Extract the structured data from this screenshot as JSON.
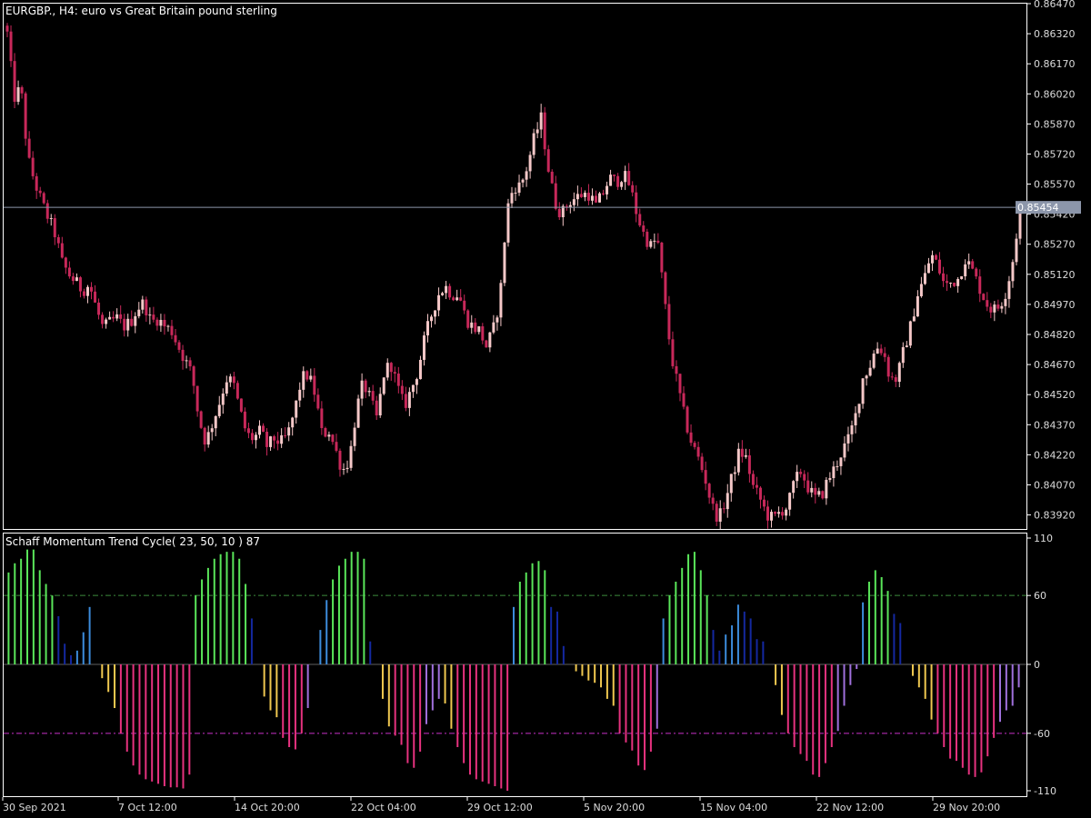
{
  "main_chart": {
    "title": "EURGBP., H4:  euro vs Great Britain pound sterling",
    "current_price": "0.85454",
    "current_price_value": 0.85454,
    "y_ticks": [
      "0.86470",
      "0.86320",
      "0.86170",
      "0.86020",
      "0.85870",
      "0.85720",
      "0.85570",
      "0.85420",
      "0.85270",
      "0.85120",
      "0.84970",
      "0.84820",
      "0.84670",
      "0.84520",
      "0.84370",
      "0.84220",
      "0.84070",
      "0.83920"
    ],
    "colors": {
      "bull_candle": "#f5c8c8",
      "bear_candle": "#c8285a",
      "last_price_line": "#8c96aa",
      "price_tag_bg": "#8c96aa",
      "frame": "#ffffff",
      "background": "#000000"
    }
  },
  "indicator": {
    "title": "Schaff Momentum Trend Cycle( 23, 50, 10 ) 87",
    "y_ticks": [
      "110",
      "60",
      "0",
      "-60",
      "-110"
    ],
    "levels": [
      60,
      -60
    ],
    "colors": {
      "strong_up": "#5ae65a",
      "up": "#3c8cdc",
      "up_weak": "#1428a0",
      "strong_down": "#e6327f",
      "down": "#f0c850",
      "down_weak": "#a070dc",
      "level_up": "#3c8c3c",
      "level_down": "#c832c8"
    }
  },
  "x_axis": {
    "labels": [
      "30 Sep 2021",
      "7 Oct 12:00",
      "14 Oct 20:00",
      "22 Oct 04:00",
      "29 Oct 12:00",
      "5 Nov 20:00",
      "15 Nov 04:00",
      "22 Nov 12:00",
      "29 Nov 20:00"
    ]
  },
  "chart_data": [
    {
      "type": "candlestick",
      "title": "EURGBP., H4:  euro vs Great Britain pound sterling",
      "ylim": [
        0.8385,
        0.8647
      ],
      "x": [
        "30 Sep 2021",
        "7 Oct 12:00",
        "14 Oct 20:00",
        "22 Oct 04:00",
        "29 Oct 12:00",
        "5 Nov 20:00",
        "15 Nov 04:00",
        "22 Nov 12:00",
        "29 Nov 20:00"
      ],
      "close_path": [
        0.8632,
        0.86,
        0.8605,
        0.857,
        0.8558,
        0.8548,
        0.854,
        0.8532,
        0.8518,
        0.8512,
        0.8508,
        0.8504,
        0.8507,
        0.8495,
        0.8485,
        0.8488,
        0.849,
        0.8486,
        0.8488,
        0.8495,
        0.8498,
        0.8488,
        0.849,
        0.8486,
        0.8484,
        0.8476,
        0.8469,
        0.8462,
        0.844,
        0.8428,
        0.8438,
        0.8448,
        0.846,
        0.8458,
        0.8444,
        0.8432,
        0.843,
        0.8434,
        0.8426,
        0.843,
        0.8428,
        0.8432,
        0.8444,
        0.846,
        0.8462,
        0.8452,
        0.8432,
        0.8434,
        0.8424,
        0.8414,
        0.842,
        0.8444,
        0.8458,
        0.845,
        0.844,
        0.8462,
        0.8468,
        0.8456,
        0.8446,
        0.8454,
        0.8464,
        0.848,
        0.8492,
        0.8502,
        0.8506,
        0.8502,
        0.8502,
        0.849,
        0.8486,
        0.8484,
        0.8476,
        0.8484,
        0.85,
        0.8544,
        0.8556,
        0.8556,
        0.8566,
        0.858,
        0.859,
        0.8566,
        0.8548,
        0.8542,
        0.8548,
        0.855,
        0.8552,
        0.8552,
        0.8546,
        0.8552,
        0.856,
        0.8558,
        0.8562,
        0.8556,
        0.8542,
        0.8532,
        0.8526,
        0.853,
        0.85,
        0.8472,
        0.8456,
        0.844,
        0.8428,
        0.842,
        0.841,
        0.8396,
        0.839,
        0.84,
        0.8412,
        0.8424,
        0.842,
        0.8406,
        0.84,
        0.8392,
        0.839,
        0.8394,
        0.8396,
        0.8408,
        0.8414,
        0.8406,
        0.84,
        0.8402,
        0.841,
        0.8416,
        0.8424,
        0.843,
        0.8442,
        0.846,
        0.8466,
        0.8476,
        0.8474,
        0.846,
        0.846,
        0.8474,
        0.8486,
        0.8502,
        0.851,
        0.8522,
        0.8516,
        0.8506,
        0.8508,
        0.851,
        0.852,
        0.8514,
        0.8506,
        0.8498,
        0.8494,
        0.8496,
        0.8504,
        0.852,
        0.85454
      ]
    },
    {
      "type": "bar",
      "title": "Schaff Momentum Trend Cycle( 23, 50, 10 ) 87",
      "ylim": [
        -110,
        110
      ],
      "levels": [
        60,
        -60
      ],
      "series": [
        {
          "values": [
            80,
            88,
            92,
            100,
            100,
            82,
            70,
            60,
            42,
            18,
            8,
            12,
            28,
            50,
            0,
            -12,
            -24,
            -38,
            -60,
            -76,
            -88,
            -96,
            -100,
            -102,
            -104,
            -106,
            -107,
            -107,
            -108,
            -96
          ]
        },
        {
          "values": [
            60,
            74,
            84,
            92,
            96,
            98,
            98,
            92,
            70,
            40,
            0,
            -28,
            -40,
            -46,
            -64,
            -72,
            -74,
            -60,
            -38,
            0,
            30,
            56,
            74,
            86,
            92,
            98,
            98,
            92,
            20,
            0,
            -30,
            -54,
            -62,
            -70,
            -86,
            -90,
            -76,
            -52,
            -40,
            -30,
            -34,
            -56,
            -72,
            -86,
            -96,
            -100,
            -102,
            -104,
            -106,
            -108,
            -110
          ]
        },
        {
          "values": [
            50,
            72,
            80,
            88,
            90,
            82,
            50,
            46,
            16,
            0,
            -6,
            -10,
            -14,
            -16,
            -20,
            -30,
            -36,
            -60,
            -68,
            -75,
            -88,
            -92,
            -76,
            -56,
            40,
            60,
            72,
            84,
            96,
            98,
            82,
            60,
            30,
            12,
            26,
            34,
            52,
            46,
            40,
            22,
            20,
            0
          ]
        },
        {
          "values": [
            -18,
            -44,
            -60,
            -72,
            -78,
            -84,
            -96,
            -98,
            -86,
            -72,
            -58,
            -36,
            -18,
            -4,
            54,
            72,
            82,
            76,
            64,
            44,
            36,
            0,
            -10,
            -20,
            -30,
            -48,
            -60,
            -72,
            -82,
            -84,
            -90,
            -96,
            -98,
            -94,
            -80,
            -64,
            -50,
            -40,
            -36,
            -20
          ]
        }
      ]
    }
  ]
}
